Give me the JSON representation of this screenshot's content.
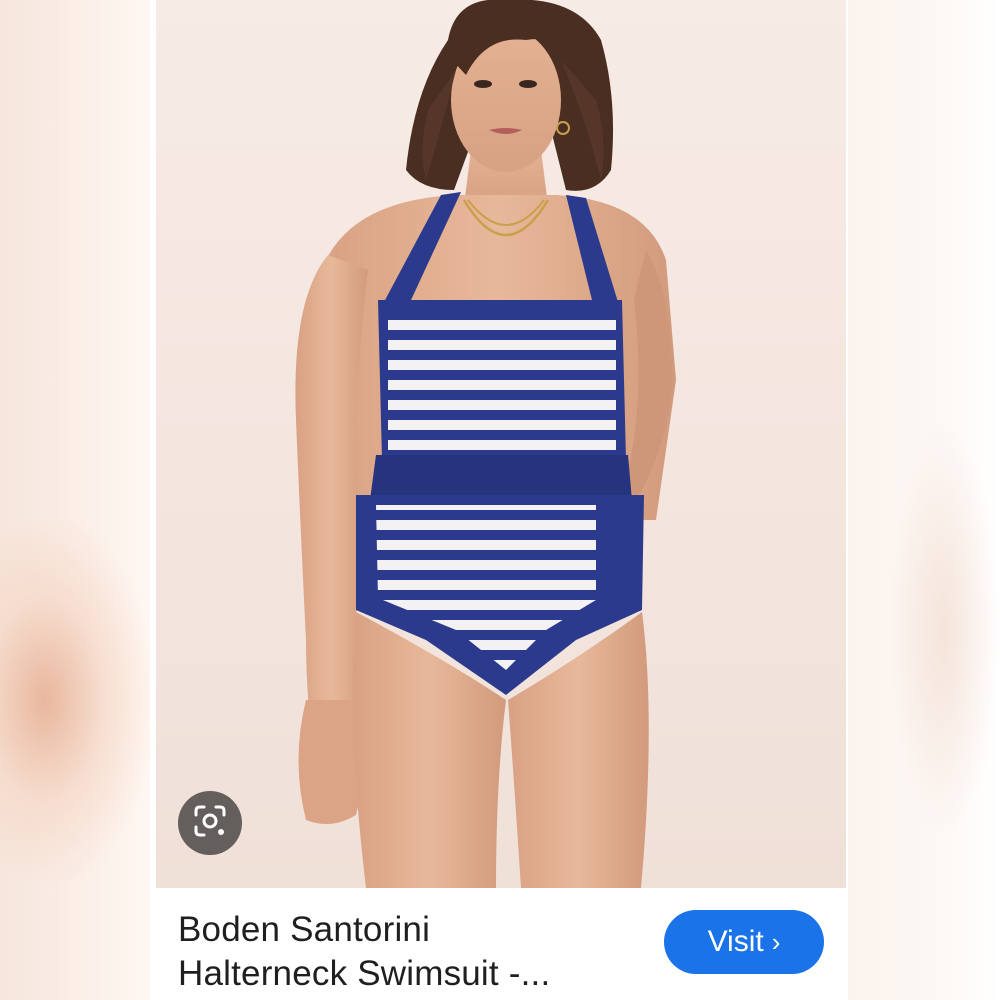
{
  "result": {
    "title_line1": "Boden Santorini",
    "title_line2": "Halterneck Swimsuit -...",
    "visit_label": "Visit",
    "visit_icon": "chevron-right-icon",
    "lens_icon": "google-lens-icon"
  },
  "colors": {
    "visit_button": "#1a73e8",
    "swimsuit_navy": "#2b3a8c",
    "stripe_white": "#f4f1f4"
  }
}
